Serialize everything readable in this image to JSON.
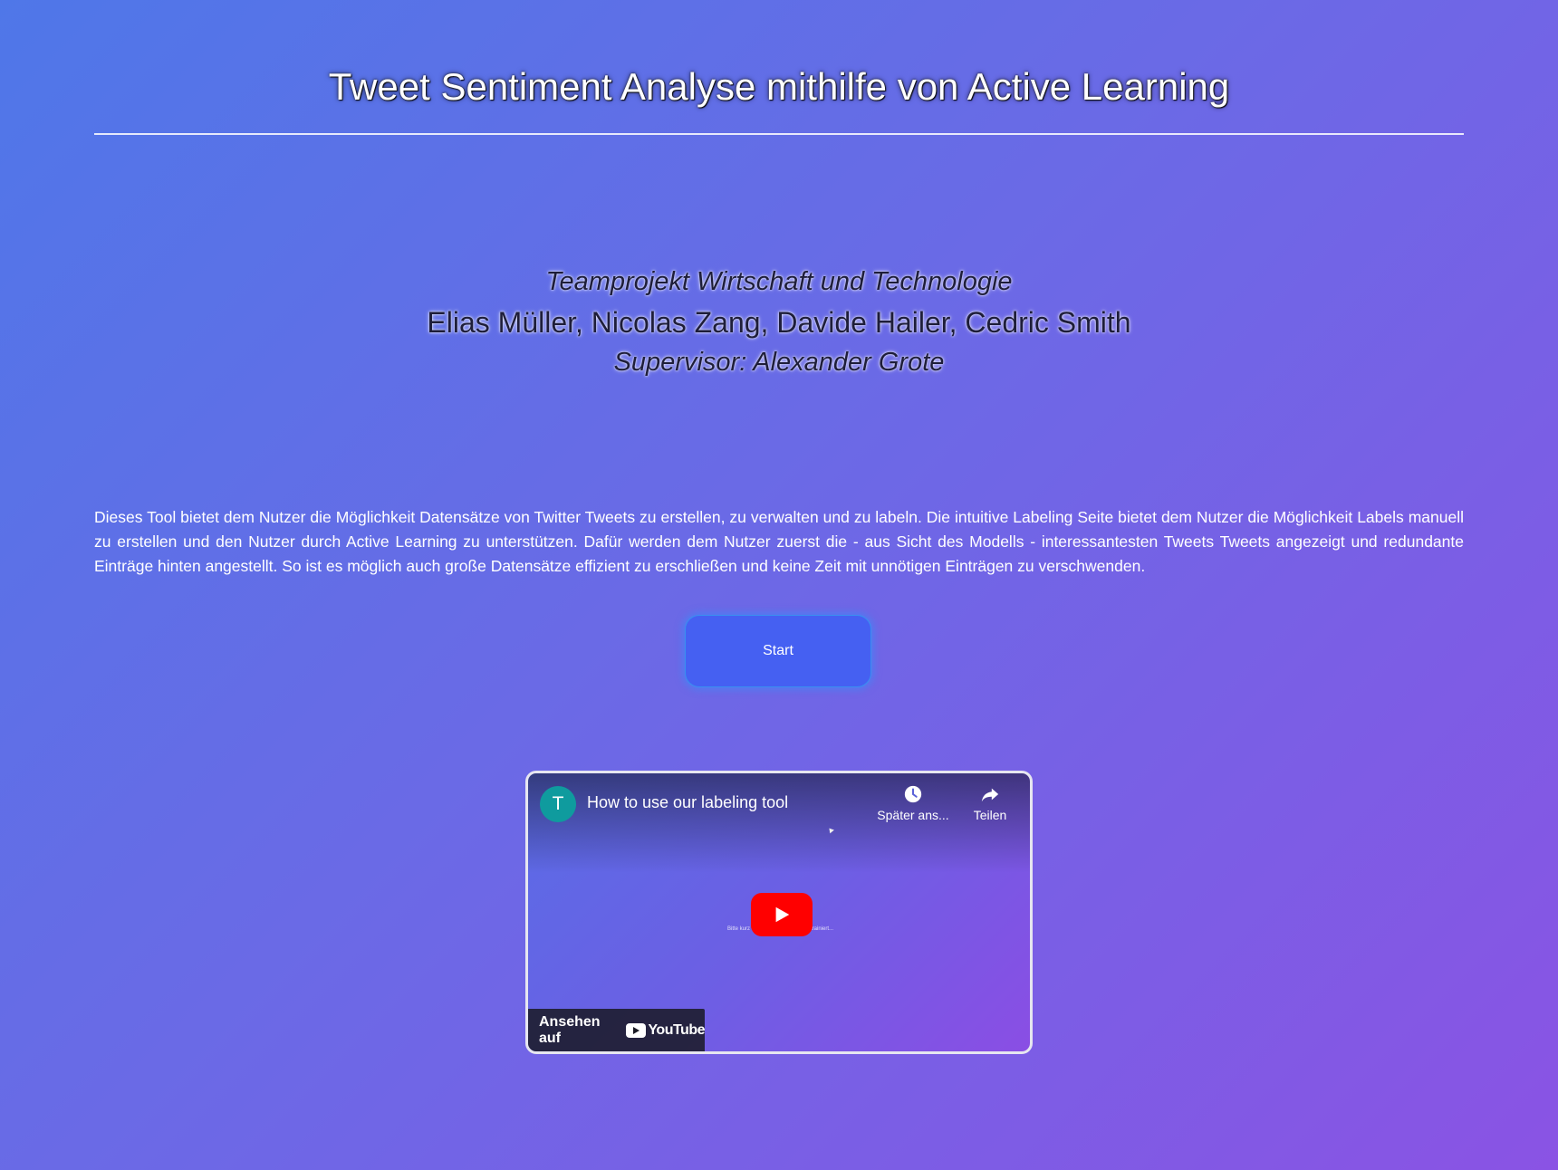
{
  "header": {
    "title": "Tweet Sentiment Analyse mithilfe von Active Learning"
  },
  "project": {
    "name": "Teamprojekt Wirtschaft und Technologie",
    "authors": "Elias Müller, Nicolas Zang, Davide Hailer, Cedric Smith",
    "supervisor": "Supervisor: Alexander Grote"
  },
  "description": "Dieses Tool bietet dem Nutzer die Möglichkeit Datensätze von Twitter Tweets zu erstellen, zu verwalten und zu labeln. Die intuitive Labeling Seite bietet dem Nutzer die Möglichkeit Labels manuell zu erstellen und den Nutzer durch Active Learning zu unterstützen. Dafür werden dem Nutzer zuerst die - aus Sicht des Modells - interessantesten Tweets Tweets angezeigt und redundante Einträge hinten angestellt. So ist es möglich auch große Datensätze effizient zu erschließen und keine Zeit mit unnötigen Einträgen zu verschwenden.",
  "start_button": {
    "label": "Start"
  },
  "video": {
    "channel_initial": "T",
    "title": "How to use our labeling tool",
    "watch_later_label": "Später ans...",
    "share_label": "Teilen",
    "thumbnail_text_left": "Bitte kurz",
    "thumbnail_text_right": "trainiert...",
    "watch_on_label": "Ansehen auf",
    "youtube_logo_text": "YouTube",
    "colors": {
      "play_button": "#ff0000",
      "avatar": "#0f9b9e"
    }
  }
}
